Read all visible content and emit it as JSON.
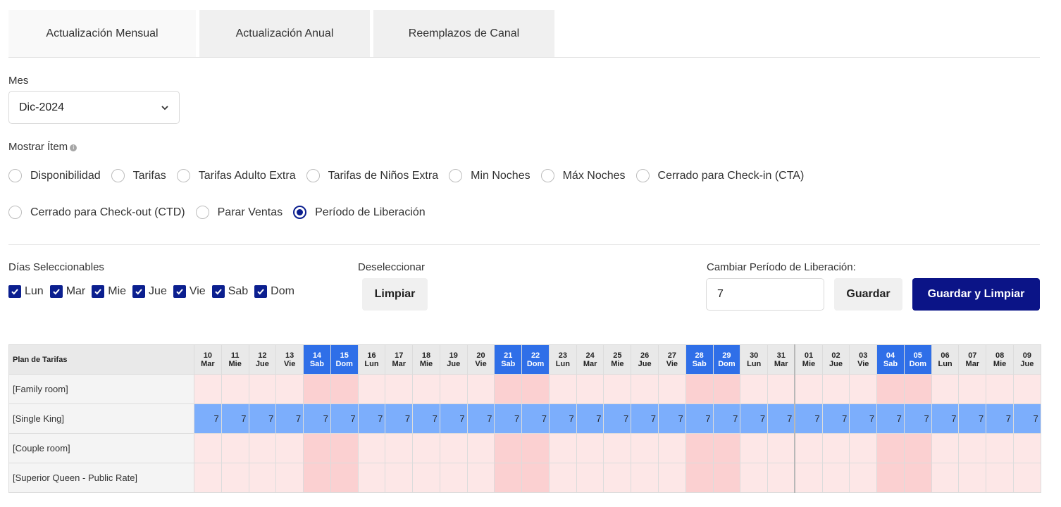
{
  "tabs": [
    {
      "label": "Actualización Mensual",
      "active": true
    },
    {
      "label": "Actualización Anual",
      "active": false
    },
    {
      "label": "Reemplazos de Canal",
      "active": false
    }
  ],
  "month": {
    "label": "Mes",
    "value": "Dic-2024"
  },
  "show_item": {
    "label": "Mostrar Ítem",
    "info_icon": "info-icon",
    "options": [
      {
        "label": "Disponibilidad",
        "checked": false
      },
      {
        "label": "Tarifas",
        "checked": false
      },
      {
        "label": "Tarifas Adulto Extra",
        "checked": false
      },
      {
        "label": "Tarifas de Niños Extra",
        "checked": false
      },
      {
        "label": "Min Noches",
        "checked": false
      },
      {
        "label": "Máx Noches",
        "checked": false
      },
      {
        "label": "Cerrado para Check-in (CTA)",
        "checked": false
      },
      {
        "label": "Cerrado para Check-out (CTD)",
        "checked": false
      },
      {
        "label": "Parar Ventas",
        "checked": false
      },
      {
        "label": "Período de Liberación",
        "checked": true
      }
    ]
  },
  "selectable_days": {
    "label": "Días Seleccionables",
    "days": [
      {
        "label": "Lun",
        "checked": true
      },
      {
        "label": "Mar",
        "checked": true
      },
      {
        "label": "Mie",
        "checked": true
      },
      {
        "label": "Jue",
        "checked": true
      },
      {
        "label": "Vie",
        "checked": true
      },
      {
        "label": "Sab",
        "checked": true
      },
      {
        "label": "Dom",
        "checked": true
      }
    ]
  },
  "deselect": {
    "label": "Deseleccionar",
    "button": "Limpiar"
  },
  "release": {
    "label": "Cambiar Período de Liberación:",
    "value": "7",
    "save": "Guardar",
    "save_clear": "Guardar y Limpiar"
  },
  "grid": {
    "plan_header": "Plan de Tarifas",
    "dates": [
      {
        "d": "10",
        "w": "Mar",
        "weekend": false
      },
      {
        "d": "11",
        "w": "Mie",
        "weekend": false
      },
      {
        "d": "12",
        "w": "Jue",
        "weekend": false
      },
      {
        "d": "13",
        "w": "Vie",
        "weekend": false
      },
      {
        "d": "14",
        "w": "Sab",
        "weekend": true
      },
      {
        "d": "15",
        "w": "Dom",
        "weekend": true
      },
      {
        "d": "16",
        "w": "Lun",
        "weekend": false
      },
      {
        "d": "17",
        "w": "Mar",
        "weekend": false
      },
      {
        "d": "18",
        "w": "Mie",
        "weekend": false
      },
      {
        "d": "19",
        "w": "Jue",
        "weekend": false
      },
      {
        "d": "20",
        "w": "Vie",
        "weekend": false
      },
      {
        "d": "21",
        "w": "Sab",
        "weekend": true
      },
      {
        "d": "22",
        "w": "Dom",
        "weekend": true
      },
      {
        "d": "23",
        "w": "Lun",
        "weekend": false
      },
      {
        "d": "24",
        "w": "Mar",
        "weekend": false
      },
      {
        "d": "25",
        "w": "Mie",
        "weekend": false
      },
      {
        "d": "26",
        "w": "Jue",
        "weekend": false
      },
      {
        "d": "27",
        "w": "Vie",
        "weekend": false
      },
      {
        "d": "28",
        "w": "Sab",
        "weekend": true
      },
      {
        "d": "29",
        "w": "Dom",
        "weekend": true
      },
      {
        "d": "30",
        "w": "Lun",
        "weekend": false
      },
      {
        "d": "31",
        "w": "Mar",
        "weekend": false
      },
      {
        "d": "01",
        "w": "Mie",
        "weekend": false,
        "month_start": true
      },
      {
        "d": "02",
        "w": "Jue",
        "weekend": false
      },
      {
        "d": "03",
        "w": "Vie",
        "weekend": false
      },
      {
        "d": "04",
        "w": "Sab",
        "weekend": true
      },
      {
        "d": "05",
        "w": "Dom",
        "weekend": true
      },
      {
        "d": "06",
        "w": "Lun",
        "weekend": false
      },
      {
        "d": "07",
        "w": "Mar",
        "weekend": false
      },
      {
        "d": "08",
        "w": "Mie",
        "weekend": false
      },
      {
        "d": "09",
        "w": "Jue",
        "weekend": false
      }
    ],
    "rows": [
      {
        "name": "[Family room]",
        "value": "",
        "highlight": false
      },
      {
        "name": "[Single King]",
        "value": "7",
        "highlight": true
      },
      {
        "name": "[Couple room]",
        "value": "",
        "highlight": false
      },
      {
        "name": "[Superior Queen - Public Rate]",
        "value": "",
        "highlight": false
      }
    ]
  }
}
